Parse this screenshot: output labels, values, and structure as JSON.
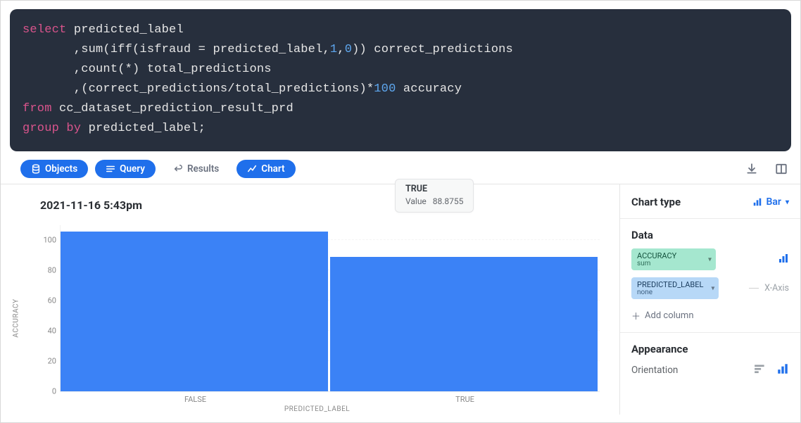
{
  "code": {
    "tokens": [
      {
        "t": "select",
        "c": "kw"
      },
      {
        "t": " predicted_label\n"
      },
      {
        "t": "       ,sum(iff(isfraud = predicted_label,"
      },
      {
        "t": "1",
        "c": "num"
      },
      {
        "t": ","
      },
      {
        "t": "0",
        "c": "num"
      },
      {
        "t": ")) correct_predictions\n"
      },
      {
        "t": "       ,count(*) total_predictions\n"
      },
      {
        "t": "       ,(correct_predictions/total_predictions)*"
      },
      {
        "t": "100",
        "c": "num"
      },
      {
        "t": " accuracy\n"
      },
      {
        "t": "from",
        "c": "kw"
      },
      {
        "t": " cc_dataset_prediction_result_prd\n"
      },
      {
        "t": "group by",
        "c": "kw"
      },
      {
        "t": " predicted_label;"
      }
    ]
  },
  "toolbar": {
    "objects": "Objects",
    "query": "Query",
    "results": "Results",
    "chart": "Chart"
  },
  "timestamp": "2021-11-16 5:43pm",
  "tooltip": {
    "title": "TRUE",
    "value_label": "Value",
    "value": "88.8755"
  },
  "sidebar": {
    "charttype_label": "Chart type",
    "charttype_value": "Bar",
    "data_label": "Data",
    "chip_accuracy": {
      "name": "ACCURACY",
      "agg": "sum"
    },
    "chip_predicted": {
      "name": "PREDICTED_LABEL",
      "agg": "none"
    },
    "xaxis_label": "X-Axis",
    "add_column": "Add column",
    "appearance_label": "Appearance",
    "orientation_label": "Orientation"
  },
  "chart_data": {
    "type": "bar",
    "title": "",
    "xlabel": "PREDICTED_LABEL",
    "ylabel": "ACCURACY",
    "ylim": [
      0,
      110
    ],
    "yticks": [
      0,
      20,
      40,
      60,
      80,
      100
    ],
    "categories": [
      "FALSE",
      "TRUE"
    ],
    "values": [
      106,
      88.8755
    ]
  }
}
